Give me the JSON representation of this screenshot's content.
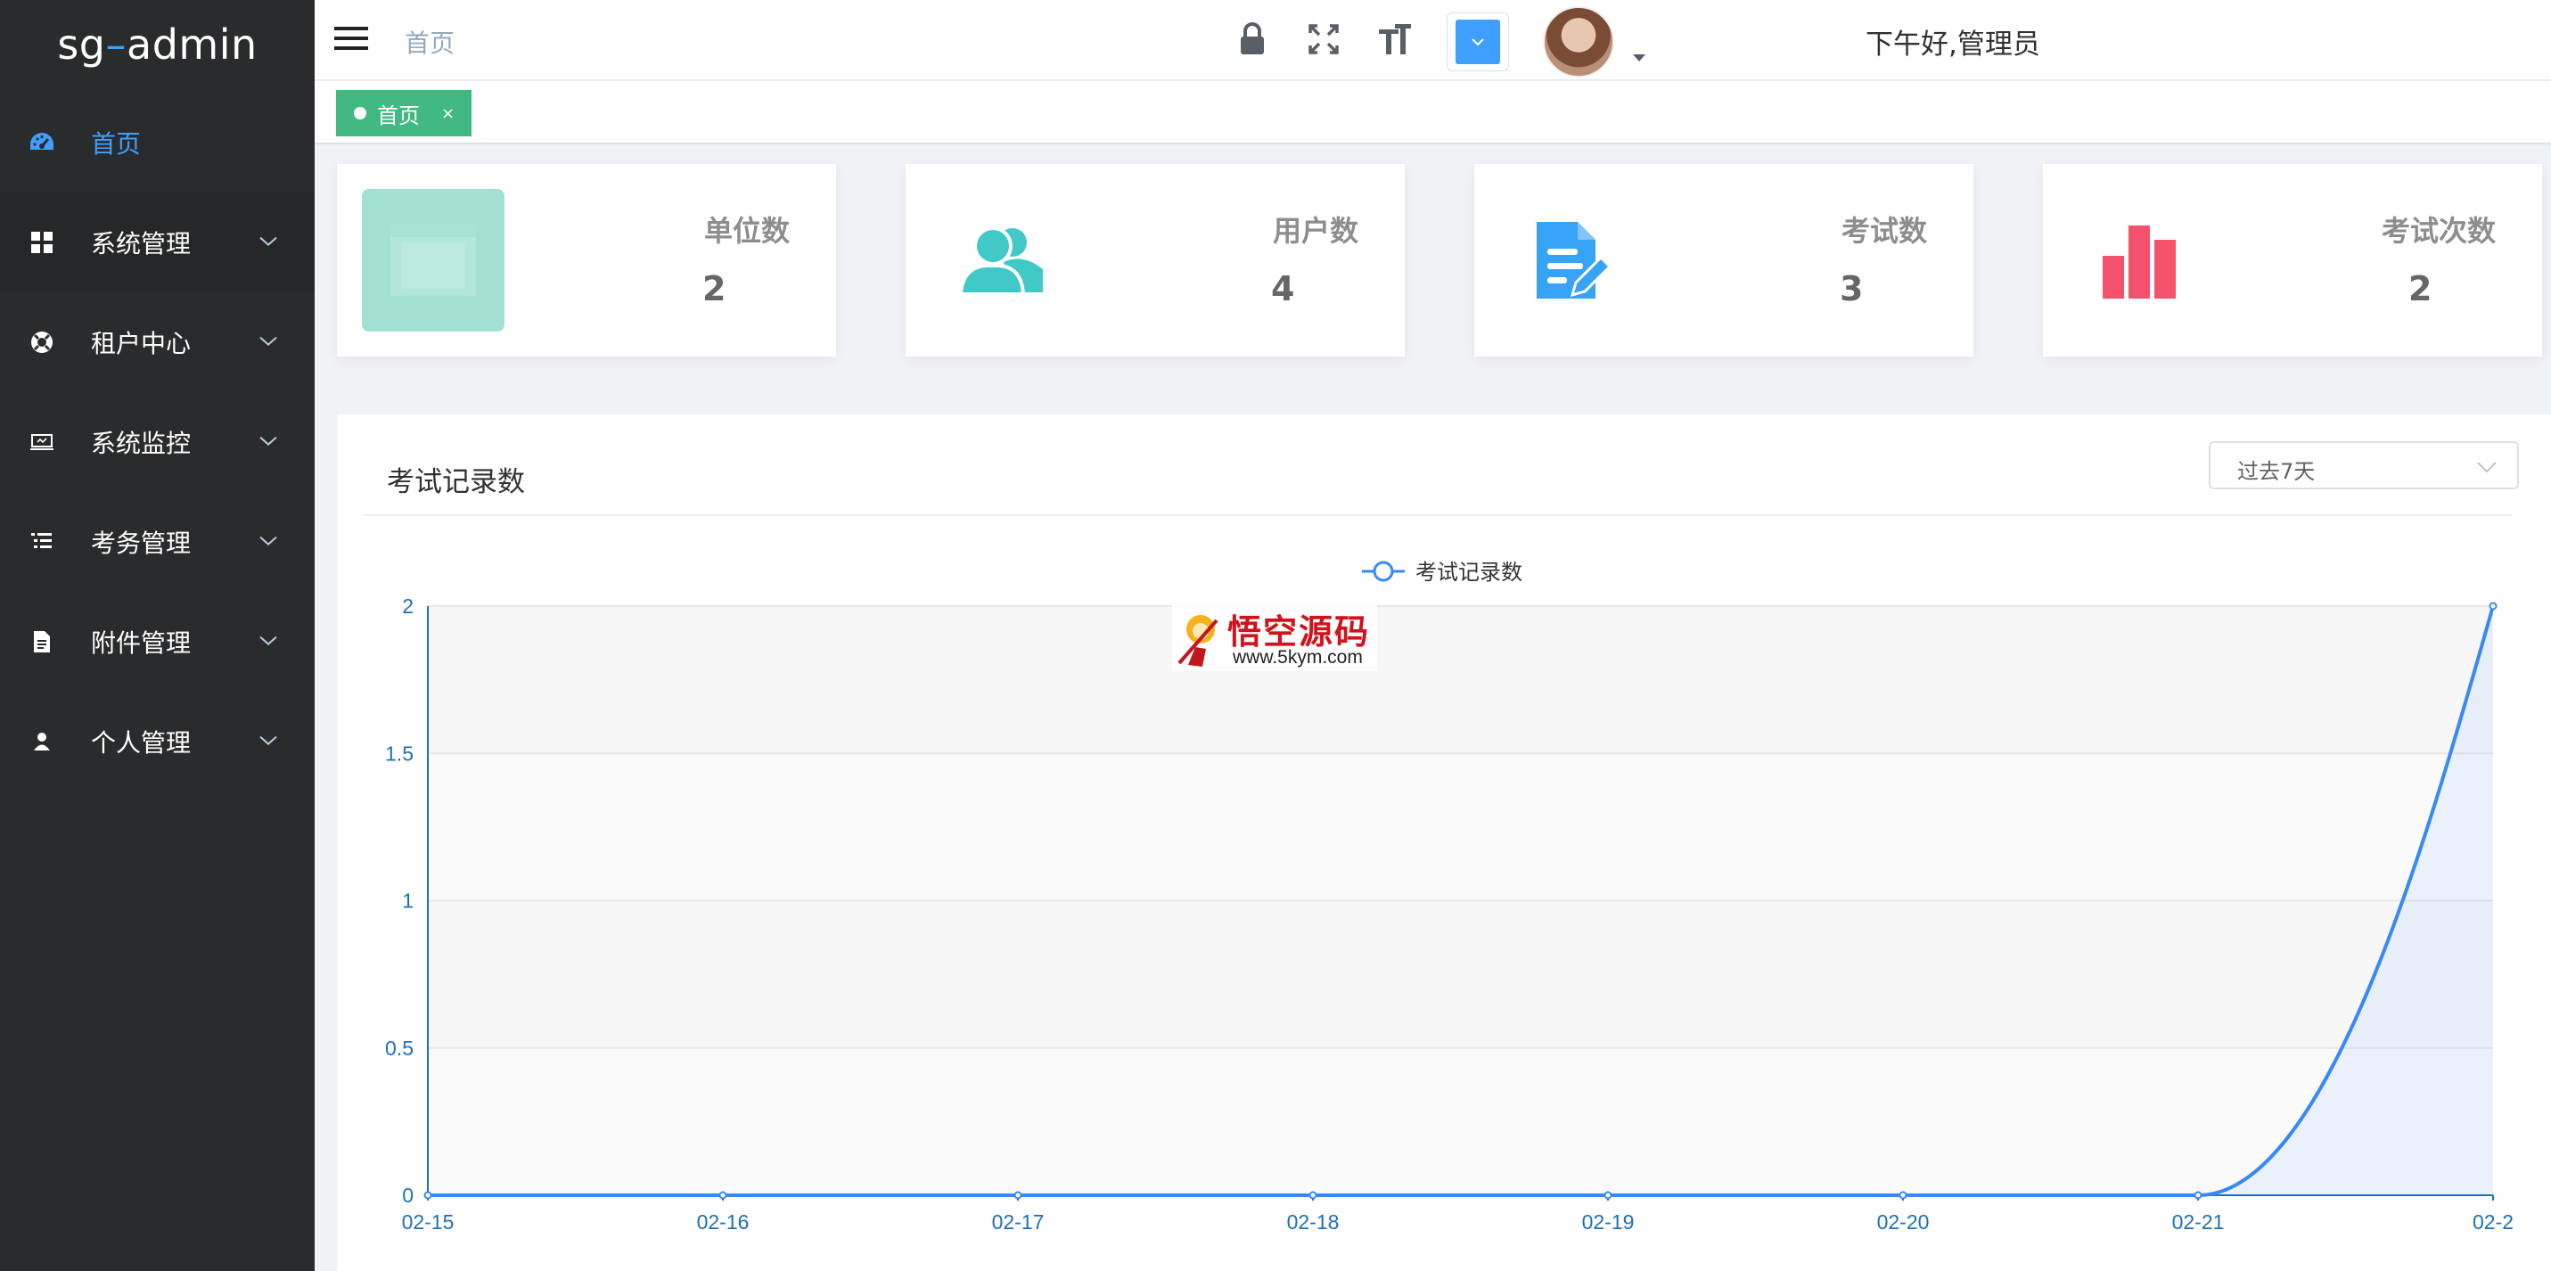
{
  "app": {
    "logo_prefix": "sg",
    "logo_dash": "–",
    "logo_suffix": "admin"
  },
  "colors": {
    "accent": "#409eff",
    "sidebar_bg": "#2a2b2c",
    "tag_green": "#42b983",
    "teal": "#40c9c6",
    "blue": "#36a3f7",
    "red": "#f4516c"
  },
  "sidebar": {
    "items": [
      {
        "label": "首页",
        "icon": "dashboard-icon",
        "active": true
      },
      {
        "label": "系统管理",
        "icon": "grid-icon"
      },
      {
        "label": "租户中心",
        "icon": "lifebuoy-icon"
      },
      {
        "label": "系统监控",
        "icon": "monitor-icon"
      },
      {
        "label": "考务管理",
        "icon": "list-icon"
      },
      {
        "label": "附件管理",
        "icon": "file-icon"
      },
      {
        "label": "个人管理",
        "icon": "user-icon"
      }
    ]
  },
  "header": {
    "breadcrumb": "首页",
    "greeting": "下午好,管理员",
    "icons": [
      "lock-icon",
      "fullscreen-icon",
      "font-size-icon"
    ],
    "theme_color": "#409eff"
  },
  "tags": [
    {
      "label": "首页",
      "close": "×"
    }
  ],
  "stats": [
    {
      "label": "单位数",
      "value": "2",
      "icon": "unit-icon"
    },
    {
      "label": "用户数",
      "value": "4",
      "icon": "users-icon"
    },
    {
      "label": "考试数",
      "value": "3",
      "icon": "exam-edit-icon"
    },
    {
      "label": "考试次数",
      "value": "2",
      "icon": "bar-chart-icon"
    }
  ],
  "chart_panel": {
    "title": "考试记录数",
    "range_select": {
      "value": "过去7天"
    }
  },
  "watermark": {
    "text_cn": "悟空源码",
    "text_url": "www.5kym.com"
  },
  "chart_data": {
    "type": "line",
    "legend": [
      "考试记录数"
    ],
    "categories": [
      "02-15",
      "02-16",
      "02-17",
      "02-18",
      "02-19",
      "02-20",
      "02-21",
      "02-2"
    ],
    "series": [
      {
        "name": "考试记录数",
        "values": [
          0,
          0,
          0,
          0,
          0,
          0,
          0,
          2
        ]
      }
    ],
    "ylim": [
      0,
      2
    ],
    "yticks": [
      "0",
      "0.5",
      "1",
      "1.5",
      "2"
    ],
    "smooth": true,
    "area_fill": true,
    "grid": true
  }
}
